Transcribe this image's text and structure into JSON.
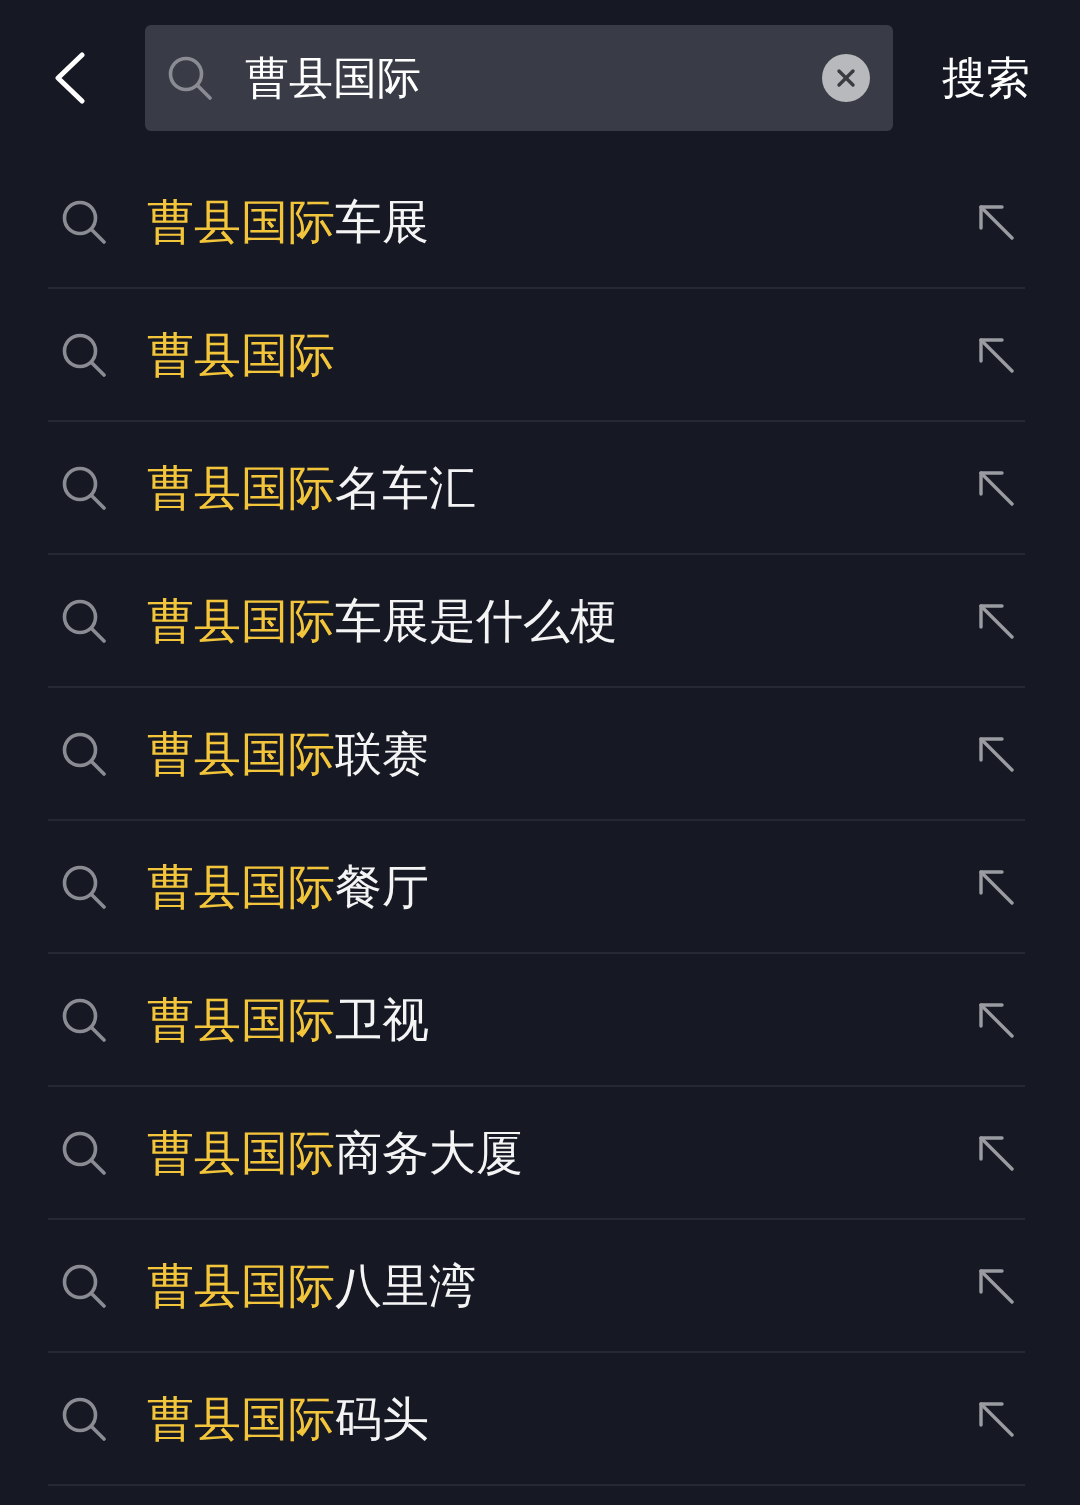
{
  "top_bar": {
    "search_field": {
      "value": "曹县国际"
    },
    "search_button": "搜索"
  },
  "suggestions": [
    {
      "highlight": "曹县国际",
      "suffix": "车展"
    },
    {
      "highlight": "曹县国际"
    },
    {
      "highlight": "曹县国际",
      "suffix": "名车汇"
    },
    {
      "highlight": "曹县国际",
      "suffix": "车展是什么梗"
    },
    {
      "highlight": "曹县国际",
      "suffix": "联赛"
    },
    {
      "highlight": "曹县国际",
      "suffix": "餐厅"
    },
    {
      "highlight": "曹县国际",
      "suffix": "卫视"
    },
    {
      "highlight": "曹县国际",
      "suffix": "商务大厦"
    },
    {
      "highlight": "曹县国际",
      "suffix": "八里湾"
    },
    {
      "highlight": "曹县国际",
      "suffix": "码头"
    }
  ]
}
